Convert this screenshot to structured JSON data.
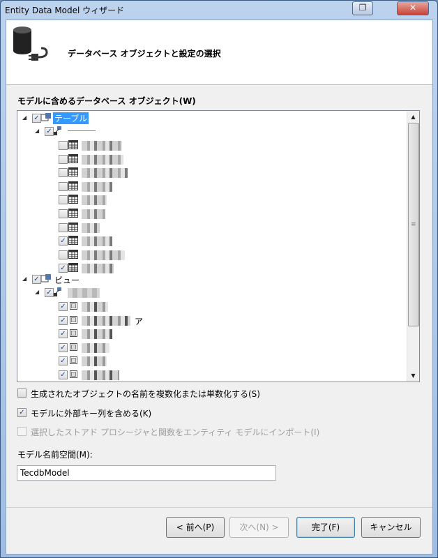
{
  "window": {
    "title": "Entity Data Model ウィザード"
  },
  "header": {
    "title": "データベース オブジェクトと設定の選択"
  },
  "tree_section": {
    "label": "モデルに含めるデータベース オブジェクト(W)"
  },
  "tree": {
    "tables_label": "テーブル",
    "views_label": "ビュー",
    "view_partial_label": "ア",
    "table_rows_checked": [
      false,
      false,
      false,
      false,
      false,
      false,
      false,
      true,
      false,
      true
    ],
    "view_rows_checked": [
      true,
      true,
      true,
      true,
      true,
      true
    ]
  },
  "options": {
    "pluralize": {
      "label": "生成されたオブジェクトの名前を複数化または単数化する(S)",
      "checked": false
    },
    "foreign_keys": {
      "label": "モデルに外部キー列を含める(K)",
      "checked": true
    },
    "import_sprocs": {
      "label": "選択したストアド プロシージャと関数をエンティティ モデルにインポート(I)",
      "checked": false
    }
  },
  "namespace": {
    "label": "モデル名前空間(M):",
    "value": "TecdbModel"
  },
  "buttons": {
    "back": "< 前へ(P)",
    "next": "次へ(N) >",
    "finish": "完了(F)",
    "cancel": "キャンセル"
  },
  "icons": {
    "restore": "restore-icon",
    "close": "close-icon",
    "database": "database-plug-icon",
    "table": "table-icon",
    "schema": "schema-icon",
    "view": "view-icon",
    "checked_glyph": "✓",
    "expanded_glyph": "◢",
    "restore_glyph": "❐",
    "close_glyph": "✕"
  }
}
